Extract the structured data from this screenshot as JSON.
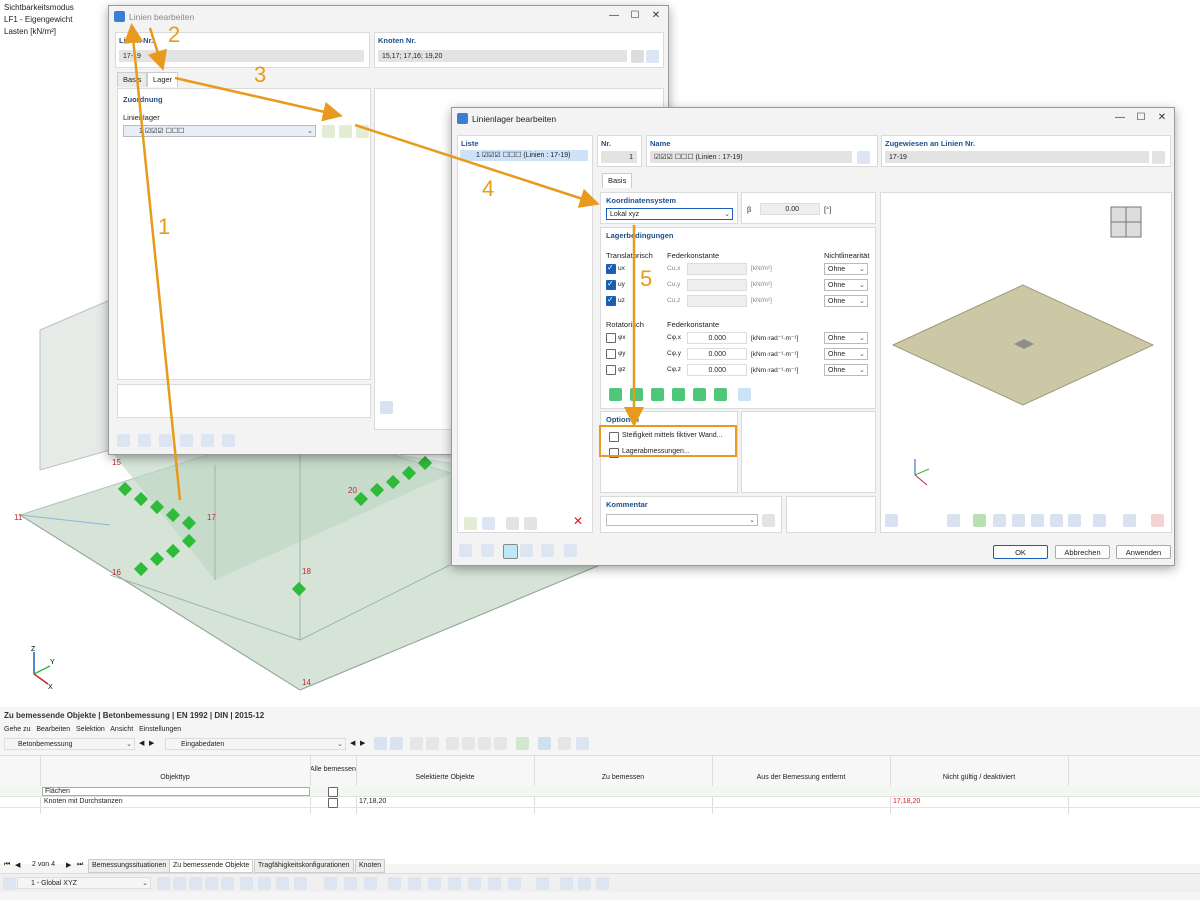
{
  "overlay": {
    "mode": "Sichtbarkeitsmodus",
    "loadcase": "LF1 - Eigengewicht",
    "loads": "Lasten [kN/m²]"
  },
  "nodes": [
    "11",
    "14",
    "15",
    "16",
    "17",
    "18",
    "20"
  ],
  "steps": [
    "1",
    "2",
    "3",
    "4",
    "5"
  ],
  "win1": {
    "title": "Linien bearbeiten",
    "line_no_label": "Linien Nr.",
    "line_no_value": "17-19",
    "node_no_label": "Knoten Nr.",
    "node_no_value": "15,17; 17,16; 19,20",
    "tabs": [
      "Basis",
      "Lager"
    ],
    "assignment_label": "Zuordnung",
    "line_support_label": "Linienlager",
    "line_support_value": "1 ☑☑☑ ☐☐☐"
  },
  "win2": {
    "title": "Linienlager bearbeiten",
    "list_label": "Liste",
    "list_item": "1 ☑☑☑ ☐☐☐ (Linien : 17-19)",
    "nr_label": "Nr.",
    "nr_value": "1",
    "name_label": "Name",
    "name_value": "☑☑☑ ☐☐☐ (Linien : 17-19)",
    "assigned_label": "Zugewiesen an Linien Nr.",
    "assigned_value": "17-19",
    "tab": "Basis",
    "coord_label": "Koordinatensystem",
    "coord_value": "Lokal xyz",
    "beta_label": "β",
    "beta_value": "0.00",
    "beta_unit": "[°]",
    "cond_label": "Lagerbedingungen",
    "trans_label": "Translatorisch",
    "spring_label": "Federkonstante",
    "nonlin_label": "Nichtlinearität",
    "trans_rows": [
      {
        "name": "ux",
        "sub": "Cu,x",
        "unit": "[kN/m²]",
        "nl": "Ohne"
      },
      {
        "name": "uy",
        "sub": "Cu,y",
        "unit": "[kN/m²]",
        "nl": "Ohne"
      },
      {
        "name": "uz",
        "sub": "Cu,z",
        "unit": "[kN/m²]",
        "nl": "Ohne"
      }
    ],
    "rot_label": "Rotatorisch",
    "rot_rows": [
      {
        "name": "φx",
        "sub": "Cφ,x",
        "val": "0.000",
        "unit": "[kNm·rad⁻¹·m⁻¹]",
        "nl": "Ohne"
      },
      {
        "name": "φy",
        "sub": "Cφ,y",
        "val": "0.000",
        "unit": "[kNm·rad⁻¹·m⁻¹]",
        "nl": "Ohne"
      },
      {
        "name": "φz",
        "sub": "Cφ,z",
        "val": "0.000",
        "unit": "[kNm·rad⁻¹·m⁻¹]",
        "nl": "Ohne"
      }
    ],
    "options_label": "Optionen",
    "opt1": "Steifigkeit mittels fiktiver Wand...",
    "opt2": "Lagerabmessungen...",
    "comment_label": "Kommentar",
    "ok": "OK",
    "cancel": "Abbrechen",
    "apply": "Anwenden"
  },
  "bottom": {
    "title": "Zu bemessende Objekte | Betonbemessung | EN 1992 | DIN | 2015-12",
    "menu": [
      "Gehe zu",
      "Bearbeiten",
      "Selektion",
      "Ansicht",
      "Einstellungen"
    ],
    "module": "Betonbemessung",
    "input": "Eingabedaten",
    "headers": [
      "Objekttyp",
      "Alle bemessen",
      "Selektierte Objekte",
      "Zu bemessen",
      "Aus der Bemessung entfernt",
      "Nicht gültig / deaktiviert"
    ],
    "rows": [
      {
        "type": "Flächen",
        "selected": "",
        "invalid": ""
      },
      {
        "type": "Knoten mit Durchstanzen",
        "selected": "17,18,20",
        "invalid": "17,18,20"
      }
    ],
    "pager": "2 von 4",
    "tabs": [
      "Bemessungssituationen",
      "Zu bemessende Objekte",
      "Tragfähigkeitskonfigurationen",
      "Knoten"
    ],
    "coord": "1 - Global XYZ"
  },
  "colors": {
    "accent": "#e89a1c",
    "blue": "#1a5fb4",
    "support_green": "#2fbb3a",
    "node_red": "#c0282d"
  }
}
